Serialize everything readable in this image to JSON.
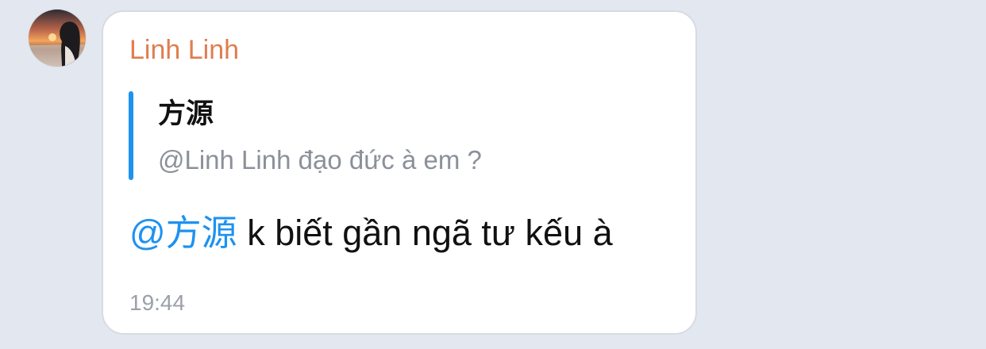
{
  "message": {
    "sender_name": "Linh Linh",
    "reply": {
      "author": "方源",
      "text": "@Linh Linh đạo đức à em ?"
    },
    "mention": "@方源",
    "body_text": " k biết gần ngã tư kếu à",
    "time": "19:44"
  },
  "colors": {
    "background": "#e3e8f0",
    "bubble": "#ffffff",
    "sender_name": "#e07d4e",
    "accent_blue": "#1d92f0",
    "secondary_text": "#8b9099",
    "time_text": "#9ba0a8"
  },
  "icons": {
    "avatar": "sunset-profile-photo"
  }
}
